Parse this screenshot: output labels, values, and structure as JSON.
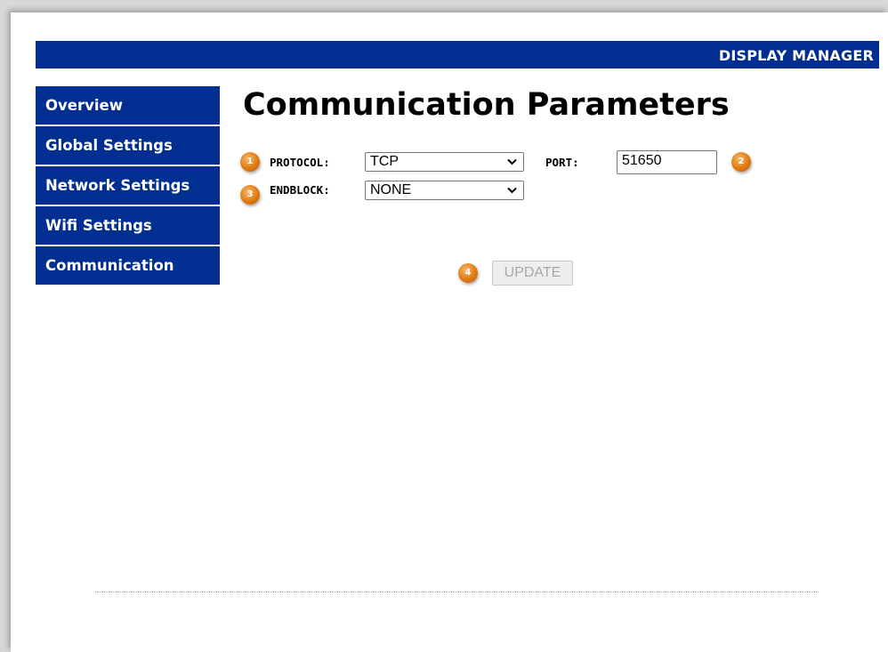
{
  "header": {
    "title": "DISPLAY MANAGER",
    "color": "#012f91"
  },
  "sidebar": {
    "items": [
      {
        "label": "Overview"
      },
      {
        "label": "Global Settings"
      },
      {
        "label": "Network Settings"
      },
      {
        "label": "Wifi Settings"
      },
      {
        "label": "Communication"
      }
    ]
  },
  "main": {
    "title": "Communication Parameters",
    "protocol": {
      "label": "PROTOCOL:",
      "value": "TCP",
      "badge": "1"
    },
    "port": {
      "label": "PORT:",
      "value": "51650",
      "badge": "2"
    },
    "endblock": {
      "label": "ENDBLOCK:",
      "value": "NONE",
      "badge": "3"
    },
    "update": {
      "label": "UPDATE",
      "badge": "4",
      "disabled": true
    }
  },
  "icons": {
    "dropdown": "chevron-down-icon",
    "callout": "numbered-callout-badge"
  },
  "colors": {
    "nav_bg": "#012f91",
    "badge": "#e07a12"
  }
}
